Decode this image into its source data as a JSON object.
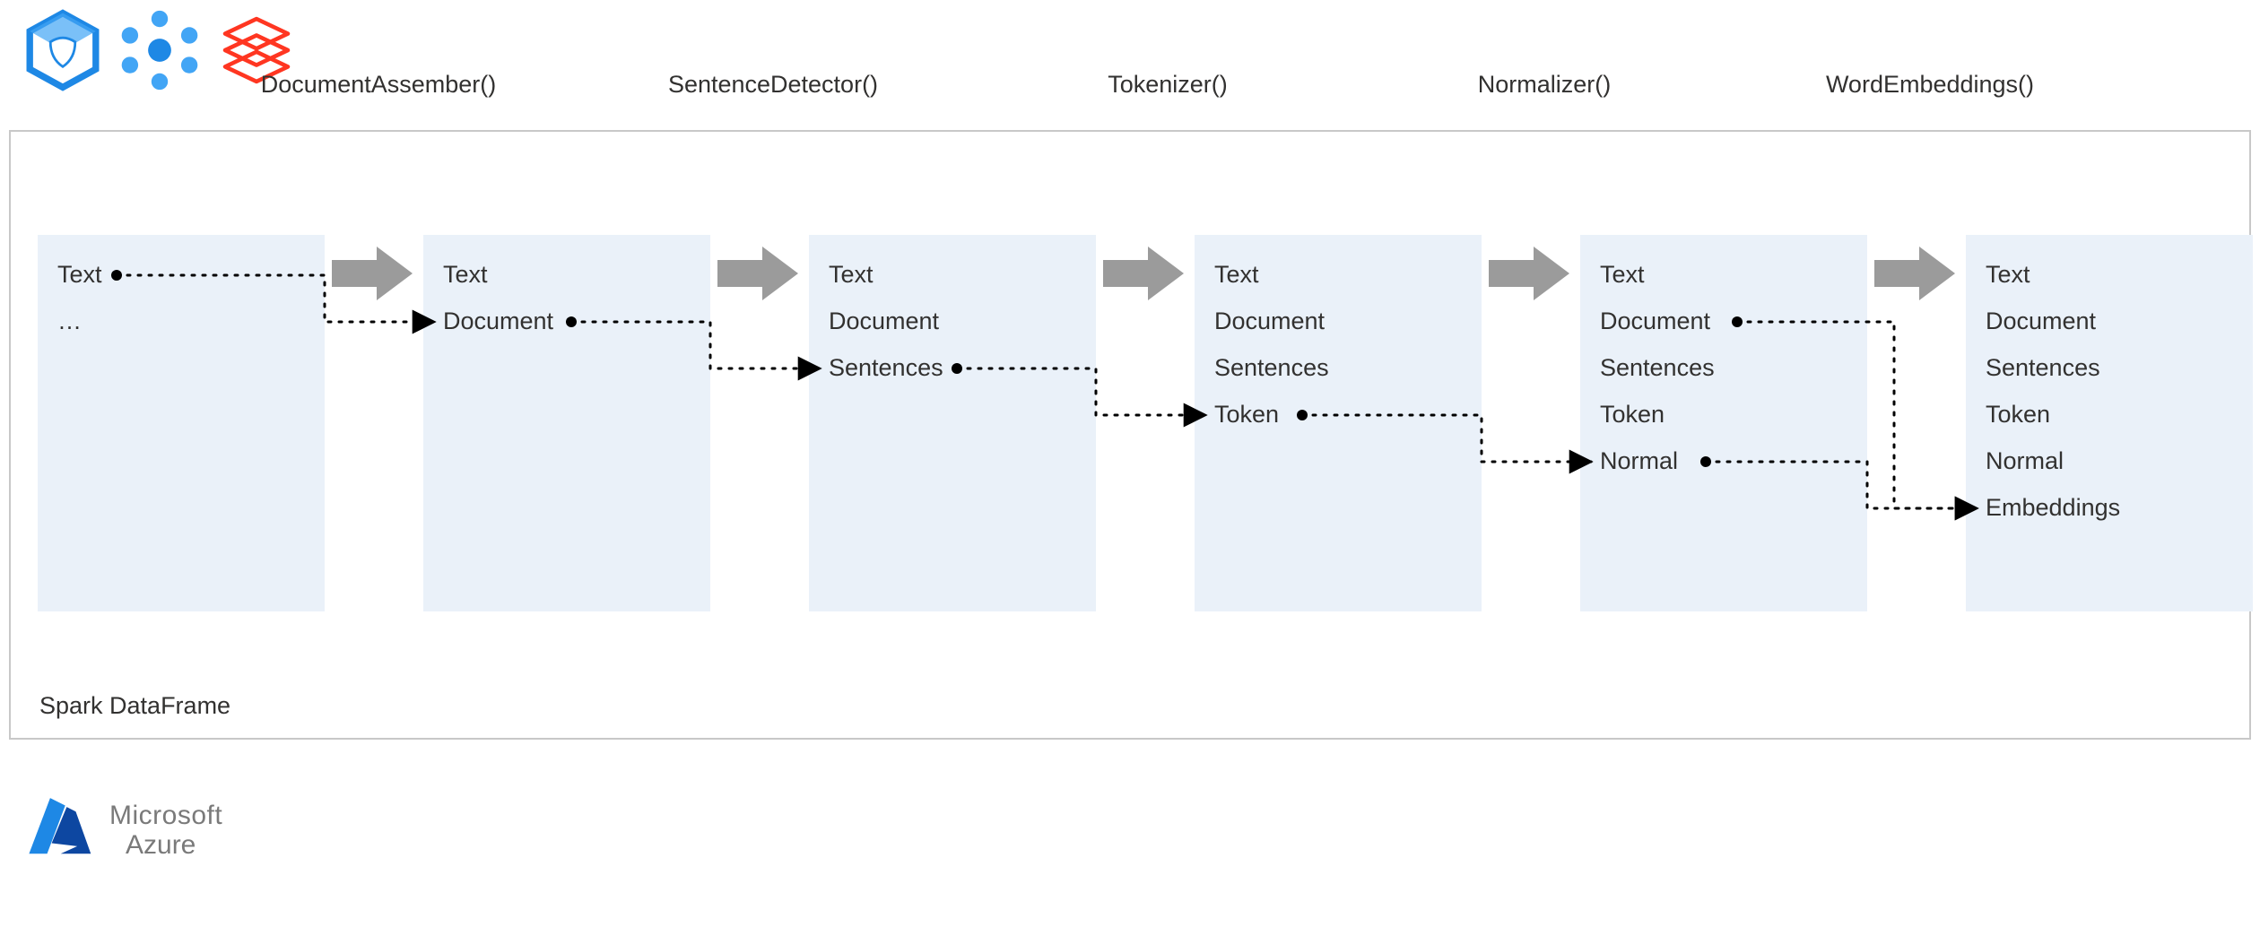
{
  "frame_label": "Spark DataFrame",
  "stages": [
    {
      "label": "",
      "rows": [
        "Text",
        "…"
      ]
    },
    {
      "label": "DocumentAssember()",
      "rows": [
        "Text",
        "Document"
      ]
    },
    {
      "label": "SentenceDetector()",
      "rows": [
        "Text",
        "Document",
        "Sentences"
      ]
    },
    {
      "label": "Tokenizer()",
      "rows": [
        "Text",
        "Document",
        "Sentences",
        "Token"
      ]
    },
    {
      "label": "Normalizer()",
      "rows": [
        "Text",
        "Document",
        "Sentences",
        "Token",
        "Normal"
      ]
    },
    {
      "label": "WordEmbeddings()",
      "rows": [
        "Text",
        "Document",
        "Sentences",
        "Token",
        "Normal",
        "Embeddings"
      ]
    }
  ],
  "bottom_logo": {
    "line1": "Microsoft",
    "line2": "Azure"
  },
  "icons": {
    "synapse": "azure-synapse-icon",
    "hdinsight": "azure-hdinsight-icon",
    "databricks": "databricks-icon",
    "azure": "azure-logo-icon"
  },
  "colors": {
    "stage_bg": "#eaf1f9",
    "frame_border": "#c8c8c8",
    "arrow": "#9b9b9b",
    "text": "#323130"
  }
}
